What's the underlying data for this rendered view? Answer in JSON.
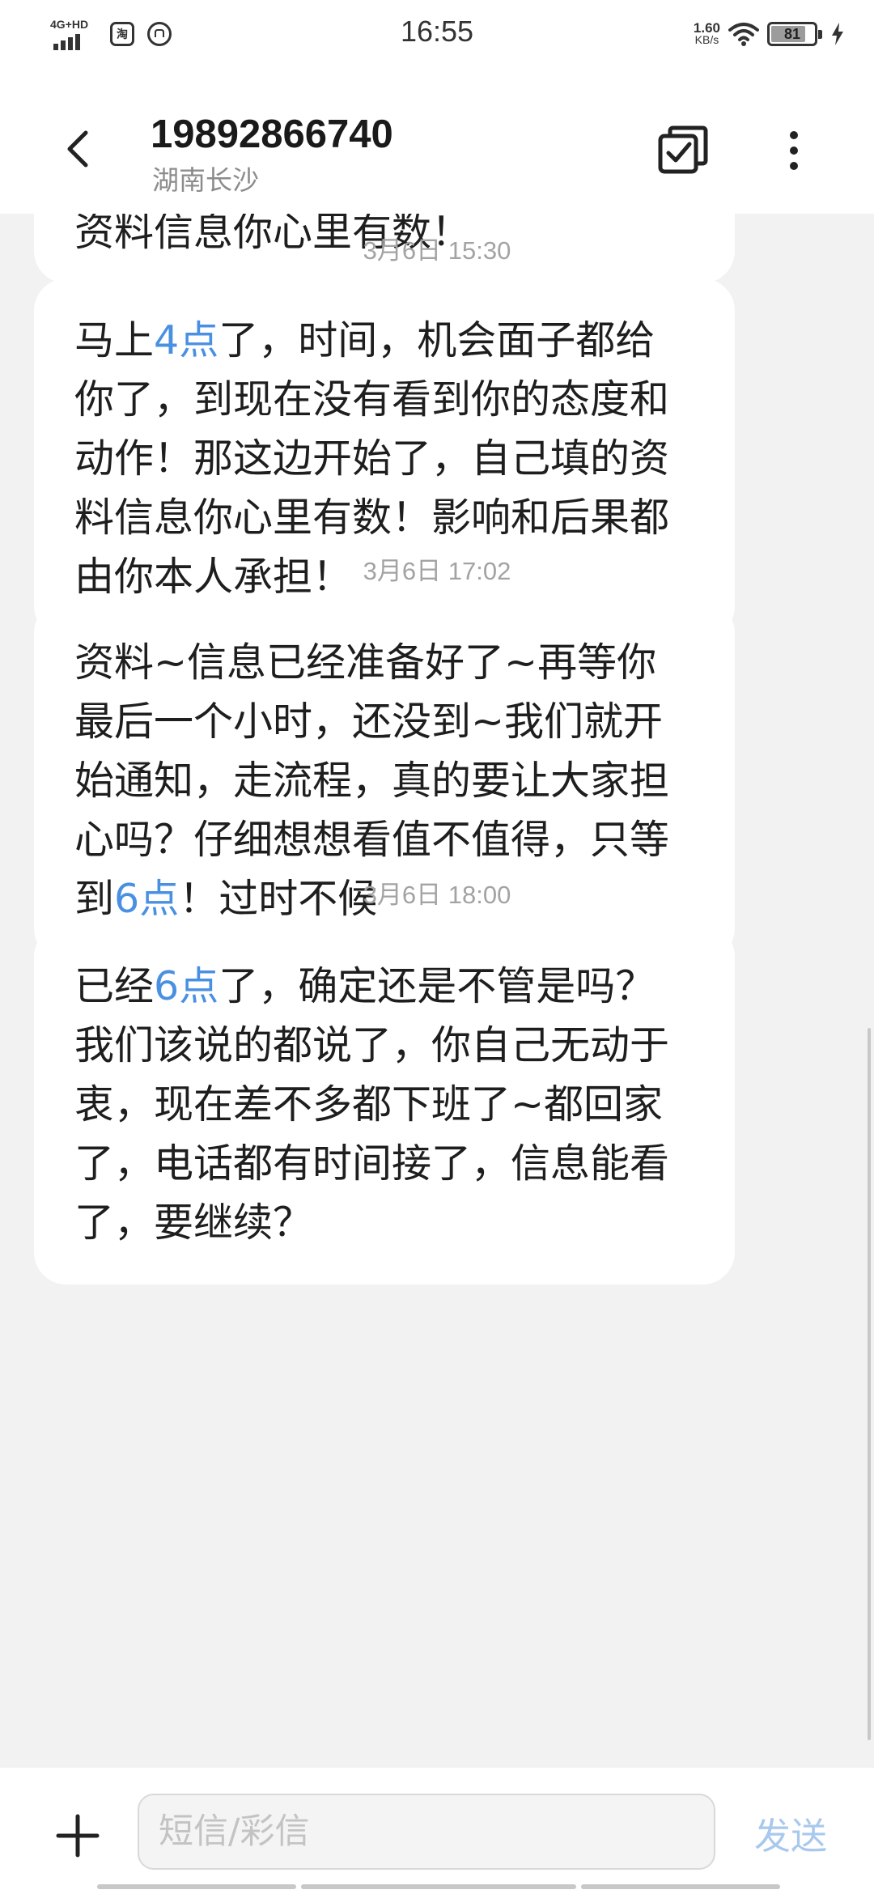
{
  "status_bar": {
    "network": "4G+HD",
    "app_icon_1": "淘",
    "time": "16:55",
    "speed_value": "1.60",
    "speed_unit": "KB/s",
    "battery": "81",
    "battery_level": 0.81,
    "icons": [
      "signal-icon",
      "taobao-app-icon",
      "notification-app-icon",
      "wifi-icon",
      "battery-icon",
      "charging-icon"
    ]
  },
  "header": {
    "title": "19892866740",
    "subtitle": "湖南长沙",
    "icons": [
      "back-arrow-icon",
      "multi-select-icon",
      "more-vertical-icon"
    ]
  },
  "messages": [
    {
      "parts": [
        {
          "text": "资料信息你心里有数！",
          "link": false
        }
      ]
    },
    {
      "timestamp": "3月6日 15:30",
      "parts": [
        {
          "text": "马上",
          "link": false
        },
        {
          "text": "4点",
          "link": true
        },
        {
          "text": "了，时间，机会面子都给你了，到现在没有看到你的态度和动作！那这边开始了，自己填的资料信息你心里有数！影响和后果都由你本人承担！",
          "link": false
        }
      ]
    },
    {
      "timestamp": "3月6日 17:02",
      "parts": [
        {
          "text": "资料~信息已经准备好了~再等你最后一个小时，还没到~我们就开始通知，走流程，真的要让大家担心吗？仔细想想看值不值得，只等到",
          "link": false
        },
        {
          "text": "6点",
          "link": true
        },
        {
          "text": "！过时不候",
          "link": false
        }
      ]
    },
    {
      "timestamp": "3月6日 18:00",
      "parts": [
        {
          "text": "已经",
          "link": false
        },
        {
          "text": "6点",
          "link": true
        },
        {
          "text": "了，确定还是不管是吗？我们该说的都说了，你自己无动于衷，现在差不多都下班了~都回家了，电话都有时间接了，信息能看了，要继续？",
          "link": false
        }
      ]
    }
  ],
  "input_bar": {
    "placeholder": "短信/彩信",
    "send_label": "发送",
    "icons": [
      "plus-icon"
    ]
  },
  "colors": {
    "link": "#4a90e2",
    "send_disabled": "#a9c8ee",
    "background": "#f2f2f2",
    "bubble": "#ffffff"
  }
}
